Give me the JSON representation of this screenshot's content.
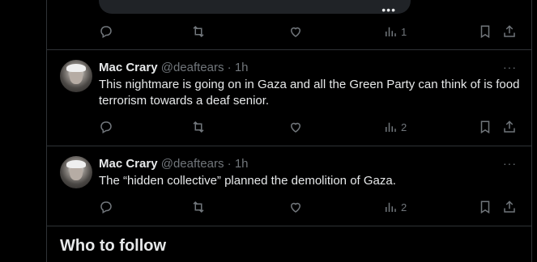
{
  "top_tweet": {
    "media_more": "•••",
    "views": "1"
  },
  "tweets": [
    {
      "name": "Mac Crary",
      "handle": "@deaftears",
      "dot": "·",
      "time": "1h",
      "text": "This nightmare is going on in Gaza and all the Green Party can think of is food terrorism towards a deaf senior.",
      "views": "2"
    },
    {
      "name": "Mac Crary",
      "handle": "@deaftears",
      "dot": "·",
      "time": "1h",
      "text": "The “hidden collective” planned the demolition of Gaza.",
      "views": "2"
    }
  ],
  "more_label": "···",
  "who_to_follow": "Who to follow",
  "colors": {
    "background": "#000000",
    "text": "#e7e9ea",
    "muted": "#71767b",
    "border": "#2f3336"
  }
}
